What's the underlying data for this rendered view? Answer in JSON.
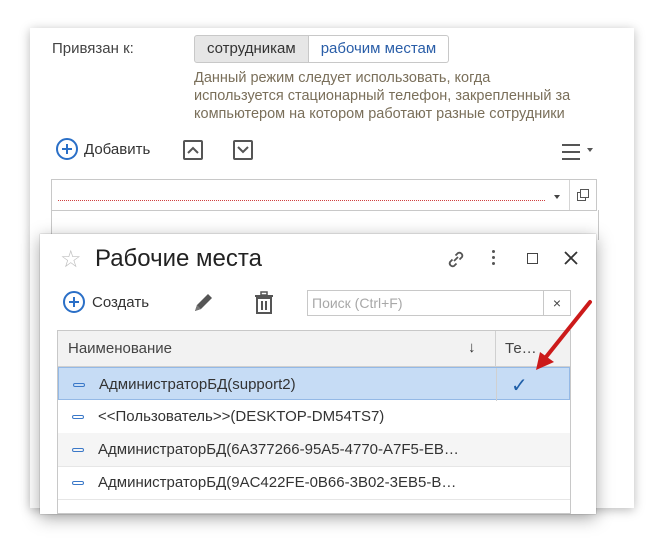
{
  "form": {
    "bound_label": "Привязан к:",
    "segment_employees": "сотрудникам",
    "segment_workplaces": "рабочим местам",
    "hint_line1": "Данный режим следует использовать, когда",
    "hint_line2": "используется стационарный телефон, закрепленный за",
    "hint_line3": "компьютером на котором работают разные сотрудники",
    "add_label": "Добавить"
  },
  "dialog": {
    "title": "Рабочие места",
    "create_label": "Создать",
    "search_placeholder": "Поиск (Ctrl+F)",
    "search_clear": "×",
    "columns": {
      "name": "Наименование",
      "sort_arrow": "↓",
      "phone": "Те…"
    },
    "rows": [
      {
        "name": "АдминистраторБД(support2)",
        "checked": "✓"
      },
      {
        "name": "<<Пользователь>>(DESKTOP-DM54TS7)"
      },
      {
        "name": "АдминистраторБД(6A377266-95A5-4770-A7F5-EB…"
      },
      {
        "name": "АдминистраторБД(9AC422FE-0B66-3B02-3EB5-B…"
      }
    ]
  },
  "colors": {
    "accent": "#2a6fc7",
    "selected_row": "#c6dcf5",
    "arrow": "#cc1a1a",
    "hint_text": "#7a6f5a"
  },
  "icons": [
    "plus-circle-icon",
    "move-up-icon",
    "move-down-icon",
    "menu-icon",
    "star-icon",
    "link-icon",
    "more-icon",
    "maximize-icon",
    "close-icon",
    "pencil-icon",
    "trash-icon"
  ]
}
